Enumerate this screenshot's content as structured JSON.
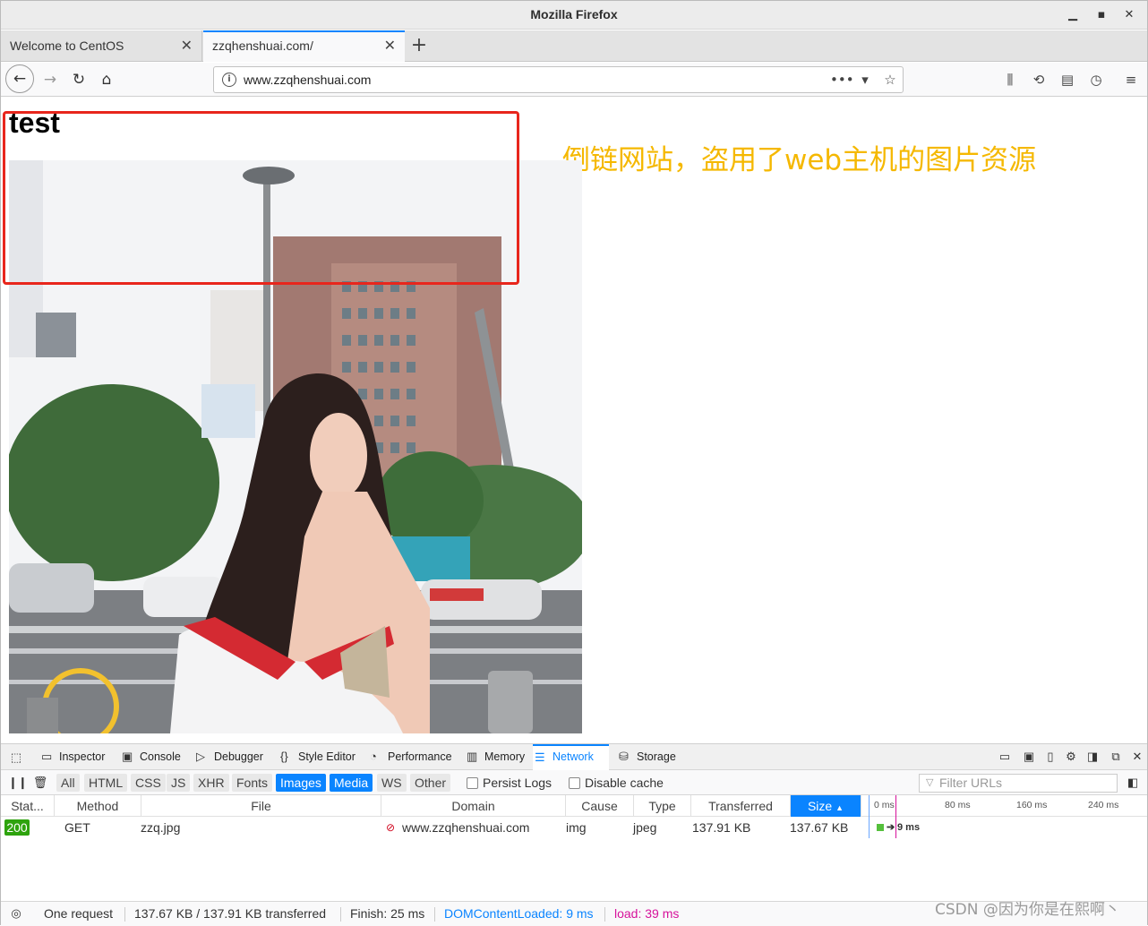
{
  "window": {
    "title": "Mozilla Firefox"
  },
  "tabs": [
    {
      "label": "Welcome to CentOS",
      "active": false
    },
    {
      "label": "zzqhenshuai.com/",
      "active": true
    }
  ],
  "nav": {
    "url": "www.zzqhenshuai.com"
  },
  "page": {
    "heading": "test",
    "annotation": "倒链网站，盗用了web主机的图片资源"
  },
  "devtools": {
    "tabs": [
      "Inspector",
      "Console",
      "Debugger",
      "Style Editor",
      "Performance",
      "Memory",
      "Network",
      "Storage"
    ],
    "active_tab": "Network",
    "filters": [
      "All",
      "HTML",
      "CSS",
      "JS",
      "XHR",
      "Fonts",
      "Images",
      "Media",
      "WS",
      "Other"
    ],
    "active_filters": [
      "Images",
      "Media"
    ],
    "persist_logs": "Persist Logs",
    "disable_cache": "Disable cache",
    "filter_placeholder": "Filter URLs",
    "columns": [
      "Stat...",
      "Method",
      "File",
      "Domain",
      "Cause",
      "Type",
      "Transferred",
      "Size"
    ],
    "timeline_ticks": [
      "0 ms",
      "80 ms",
      "160 ms",
      "240 ms"
    ],
    "rows": [
      {
        "status": "200",
        "method": "GET",
        "file": "zzq.jpg",
        "domain": "www.zzqhenshuai.com",
        "cause": "img",
        "type": "jpeg",
        "transferred": "137.91 KB",
        "size": "137.67 KB",
        "timing": "9 ms"
      }
    ],
    "statusbar": {
      "requests": "One request",
      "transferred": "137.67 KB / 137.91 KB transferred",
      "finish": "Finish: 25 ms",
      "domcontentloaded": "DOMContentLoaded: 9 ms",
      "load": "load: 39 ms"
    }
  },
  "watermark": "CSDN @因为你是在熙啊丶",
  "colors": {
    "accent": "#0a84ff",
    "annotation": "#f5b800",
    "highlight_box": "#e8261c",
    "status_ok": "#2ea30e",
    "dcl": "#0a84ff",
    "load": "#d6129b"
  }
}
